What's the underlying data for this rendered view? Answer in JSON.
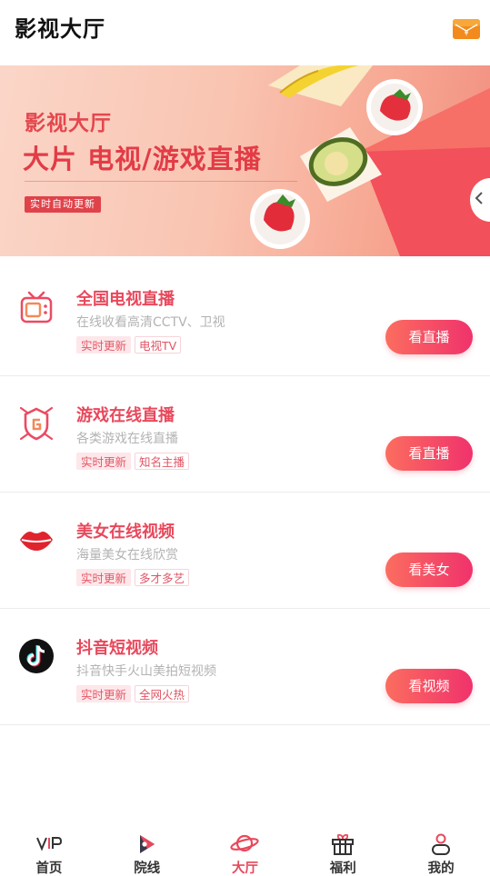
{
  "header": {
    "title": "影视大厅",
    "wallet_icon": "wallet-yen-icon"
  },
  "banner": {
    "subtitle": "影视大厅",
    "headline": "大片 电视/游戏直播",
    "tag": "实时自动更新",
    "accent_color": "#e23c47"
  },
  "items": [
    {
      "title": "全国电视直播",
      "desc": "在线收看高清CCTV、卫视",
      "tags": [
        "实时更新",
        "电视TV"
      ],
      "button": "看直播",
      "icon": "tv-icon"
    },
    {
      "title": "游戏在线直播",
      "desc": "各类游戏在线直播",
      "tags": [
        "实时更新",
        "知名主播"
      ],
      "button": "看直播",
      "icon": "game-shield-icon"
    },
    {
      "title": "美女在线视频",
      "desc": "海量美女在线欣赏",
      "tags": [
        "实时更新",
        "多才多艺"
      ],
      "button": "看美女",
      "icon": "lips-icon"
    },
    {
      "title": "抖音短视频",
      "desc": "抖音快手火山美拍短视频",
      "tags": [
        "实时更新",
        "全网火热"
      ],
      "button": "看视频",
      "icon": "tiktok-icon"
    }
  ],
  "tabbar": {
    "tabs": [
      {
        "label": "首页",
        "icon": "vip-icon"
      },
      {
        "label": "院线",
        "icon": "play-icon"
      },
      {
        "label": "大厅",
        "icon": "planet-icon",
        "active": true
      },
      {
        "label": "福利",
        "icon": "gift-icon"
      },
      {
        "label": "我的",
        "icon": "user-icon"
      }
    ],
    "active_color": "#e8485c"
  }
}
